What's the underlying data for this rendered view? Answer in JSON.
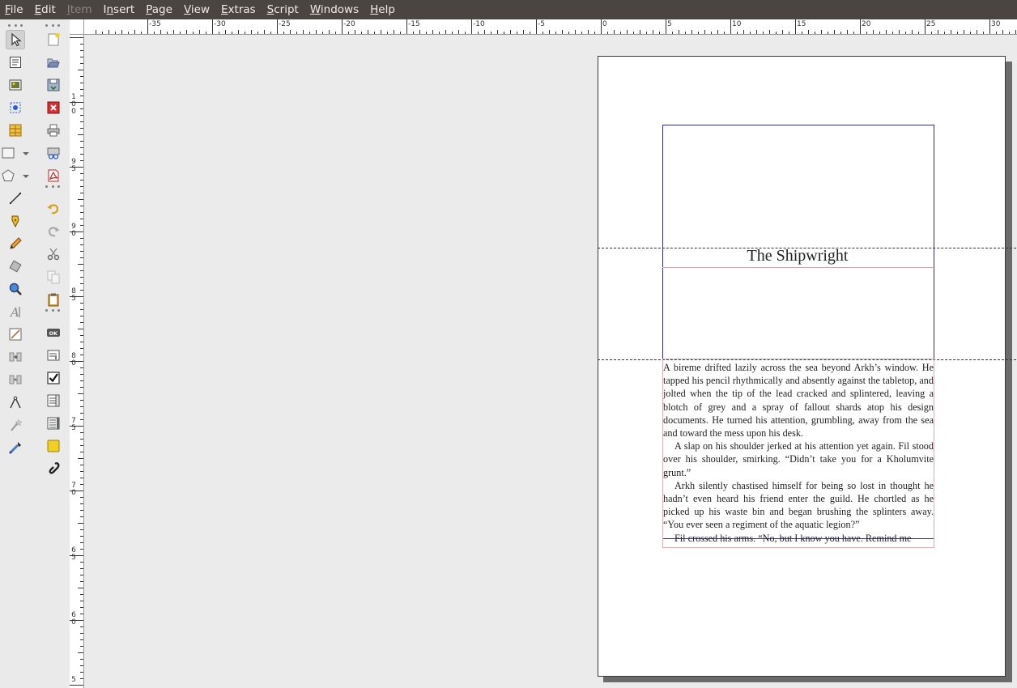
{
  "menubar": {
    "items": [
      {
        "mn": "F",
        "rest": "ile",
        "enabled": true
      },
      {
        "mn": "E",
        "rest": "dit",
        "enabled": true
      },
      {
        "mn": "I",
        "rest": "tem",
        "enabled": false
      },
      {
        "pre": "I",
        "mn": "n",
        "rest": "sert",
        "enabled": true
      },
      {
        "mn": "P",
        "rest": "age",
        "enabled": true
      },
      {
        "mn": "V",
        "rest": "iew",
        "enabled": true
      },
      {
        "mn": "E",
        "rest": "xtras",
        "enabled": true
      },
      {
        "mn": "S",
        "rest": "cript",
        "enabled": true
      },
      {
        "mn": "W",
        "rest": "indows",
        "enabled": true
      },
      {
        "mn": "H",
        "rest": "elp",
        "enabled": true
      }
    ]
  },
  "toolbox_left": {
    "tools": [
      {
        "name": "select-item-tool",
        "icon": "arrow-pointer-icon",
        "active": true
      },
      {
        "name": "text-frame-tool",
        "icon": "text-frame-icon"
      },
      {
        "name": "image-frame-tool",
        "icon": "image-frame-icon"
      },
      {
        "name": "render-frame-tool",
        "icon": "render-frame-icon"
      },
      {
        "name": "table-tool",
        "icon": "table-icon"
      },
      {
        "name": "shape-tool",
        "icon": "rectangle-icon",
        "dropdown": true
      },
      {
        "name": "polygon-tool",
        "icon": "polygon-icon",
        "dropdown": true
      },
      {
        "name": "line-tool",
        "icon": "line-icon"
      },
      {
        "name": "bezier-tool",
        "icon": "pen-icon"
      },
      {
        "name": "freehand-tool",
        "icon": "pencil-icon"
      },
      {
        "name": "rotate-tool",
        "icon": "rotate-icon"
      },
      {
        "name": "zoom-tool",
        "icon": "magnifier-icon"
      },
      {
        "name": "edit-text-tool",
        "icon": "edit-text-icon"
      },
      {
        "name": "story-editor-tool",
        "icon": "story-editor-icon"
      },
      {
        "name": "link-frames-tool",
        "icon": "link-frames-icon"
      },
      {
        "name": "unlink-frames-tool",
        "icon": "unlink-frames-icon"
      },
      {
        "name": "measure-tool",
        "icon": "compass-icon"
      },
      {
        "name": "copy-properties-tool",
        "icon": "wand-icon"
      },
      {
        "name": "eyedropper-tool",
        "icon": "eyedropper-icon"
      }
    ]
  },
  "toolbox_right": {
    "tools": [
      {
        "name": "new-document-button",
        "icon": "new-document-icon"
      },
      {
        "name": "open-document-button",
        "icon": "open-folder-icon"
      },
      {
        "name": "save-document-button",
        "icon": "save-icon"
      },
      {
        "name": "close-document-button",
        "icon": "close-document-icon"
      },
      {
        "name": "print-button",
        "icon": "printer-icon"
      },
      {
        "name": "preflight-button",
        "icon": "preflight-icon"
      },
      {
        "name": "export-pdf-button",
        "icon": "pdf-icon"
      },
      {
        "name": "undo-button",
        "icon": "undo-icon"
      },
      {
        "name": "redo-button",
        "icon": "redo-icon"
      },
      {
        "name": "cut-button",
        "icon": "scissors-icon"
      },
      {
        "name": "copy-button",
        "icon": "copy-icon"
      },
      {
        "name": "paste-button",
        "icon": "clipboard-icon"
      },
      {
        "name": "pdf-push-button",
        "icon": "pdf-button-icon"
      },
      {
        "name": "pdf-text-field",
        "icon": "pdf-textfield-icon"
      },
      {
        "name": "pdf-checkbox",
        "icon": "checkbox-icon"
      },
      {
        "name": "pdf-combo-box",
        "icon": "combobox-icon"
      },
      {
        "name": "pdf-list-box",
        "icon": "listbox-icon"
      },
      {
        "name": "text-annotation",
        "icon": "note-icon"
      },
      {
        "name": "link-annotation",
        "icon": "link-icon"
      }
    ]
  },
  "rulers": {
    "horizontal_labels": [
      "-35",
      "-30",
      "-25",
      "-20",
      "-15",
      "-10",
      "-5",
      "0",
      "5",
      "10",
      "15",
      "20",
      "25",
      "30"
    ],
    "vertical_labels": [
      "100",
      "95",
      "90",
      "85",
      "80",
      "75",
      "70",
      "65",
      "60",
      "5"
    ]
  },
  "document": {
    "title": "The Shipwright",
    "paragraphs": [
      "A bireme drifted lazily across the sea beyond Arkh’s window. He tapped his pencil rhythmically and absently against the tabletop, and jolted when the tip of the lead cracked and splintered, leaving a blotch of grey and a spray of fallout shards atop his design documents. He turned his attention, grumbling, away from the sea and toward the mess upon his desk.",
      "A slap on his shoulder jerked at his attention yet again. Fil stood over his shoulder, smirking. “Didn’t take you for a Kholumvite grunt.”",
      "Arkh silently chastised himself for being so lost in thought he hadn’t even heard his friend enter the guild. He chortled as he picked up his waste bin and began brushing the splinters away. “You ever seen a regiment of the aquatic legion?”",
      "Fil crossed his arms. “No, but I know you have. Remind me"
    ]
  },
  "colors": {
    "menubar_bg": "#4a4540",
    "margin_guide": "#2c2cb0",
    "text_frame_border": "#f0a8a8"
  }
}
